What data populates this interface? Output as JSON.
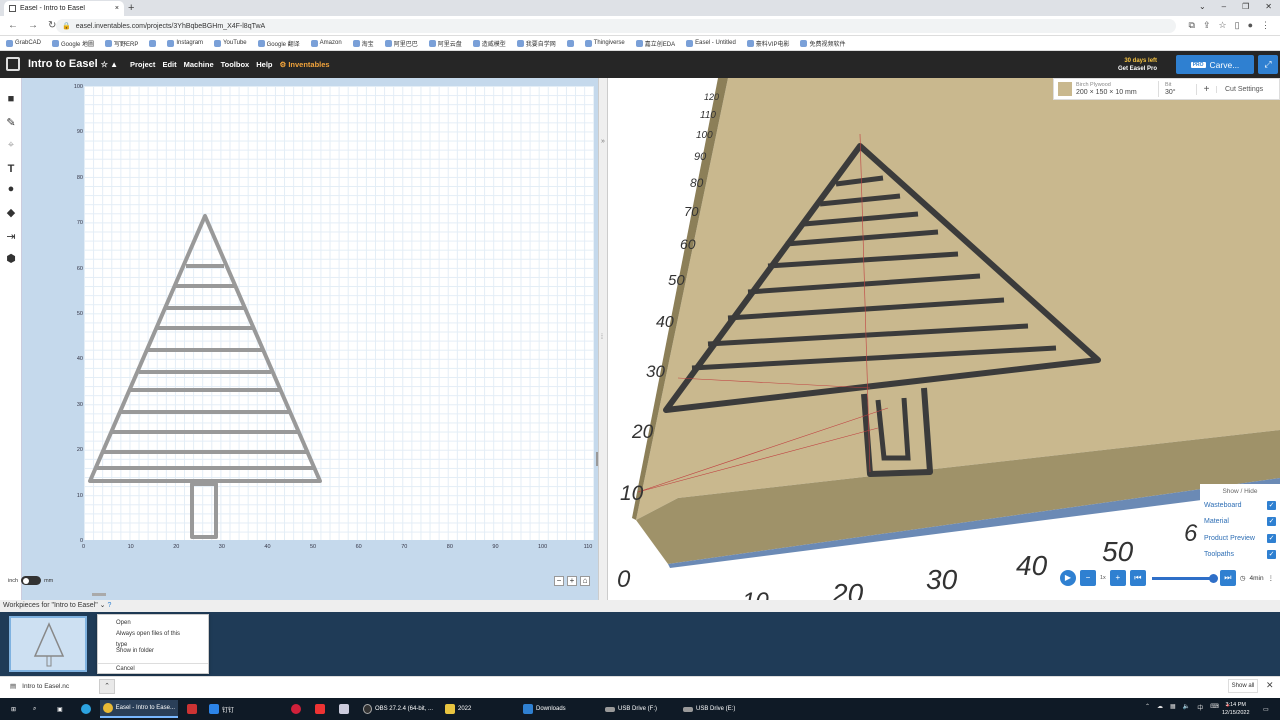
{
  "browser": {
    "tab_title": "Easel - Intro to Easel",
    "new_tab": "+",
    "url": "easel.inventables.com/projects/3YhBqbeBGHm_X4F-l8qTwA",
    "bookmarks": [
      "GrabCAD",
      "Google 地圖",
      "写野ERP",
      "",
      "Instagram",
      "YouTube",
      "Google 翻译",
      "Amazon",
      "淘宝",
      "阿里巴巴",
      "阿里云盘",
      "造威模型",
      "我要自学网",
      "",
      "Thingiverse",
      "嘉立创EDA",
      "Easel - Untitled",
      "豪料VIP电影",
      "免费视频软件"
    ]
  },
  "easel": {
    "project_title": "Intro to Easel",
    "menu": [
      "Project",
      "Edit",
      "Machine",
      "Toolbox",
      "Help",
      "Inventables"
    ],
    "trial_days": "30 days left",
    "trial_cta": "Get Easel Pro",
    "pro_badge": "PRO",
    "carve_label": "Carve..."
  },
  "design": {
    "y_ticks": [
      "100",
      "90",
      "80",
      "70",
      "60",
      "50",
      "40",
      "30",
      "20",
      "10",
      "0"
    ],
    "x_ticks": [
      "0",
      "10",
      "20",
      "30",
      "40",
      "50",
      "60",
      "70",
      "80",
      "90",
      "100",
      "110"
    ],
    "unit_left": "inch",
    "unit_right": "mm"
  },
  "preview": {
    "material_name": "Birch Plywood",
    "material_dims": "200 × 150 × 10 mm",
    "bit_label": "Bit",
    "bit_value": "30°",
    "cut_settings": "Cut Settings",
    "show_hide_title": "Show / Hide",
    "layers": [
      {
        "label": "Wasteboard",
        "checked": true
      },
      {
        "label": "Material",
        "checked": true
      },
      {
        "label": "Product Preview",
        "checked": true
      },
      {
        "label": "Toolpaths",
        "checked": true
      }
    ],
    "speed": "1x",
    "time": "4min",
    "axis_labels": [
      "120",
      "110",
      "100",
      "90",
      "80",
      "70",
      "60",
      "50",
      "40",
      "30",
      "20",
      "10",
      "0",
      "10",
      "20",
      "30",
      "40",
      "50",
      "6"
    ]
  },
  "workpieces": {
    "header": "Workpieces for \"Intro to Easel\"",
    "context_menu": [
      "Open",
      "Always open files of this type",
      "Show in folder",
      "Cancel"
    ]
  },
  "downloads": {
    "file_name": "Intro to Easel.nc",
    "show_all": "Show all"
  },
  "taskbar": {
    "items": [
      "Easel - Intro to Ease...",
      "钉钉",
      "OBS 27.2.4 (64-bit, ...",
      "2022",
      "Downloads",
      "USB Drive (F:)",
      "USB Drive (E:)"
    ],
    "time": "3:14 PM",
    "date": "12/15/2022"
  },
  "colors": {
    "accent": "#2f80d1",
    "topbar": "#262626",
    "wood": "#c9b88e"
  }
}
